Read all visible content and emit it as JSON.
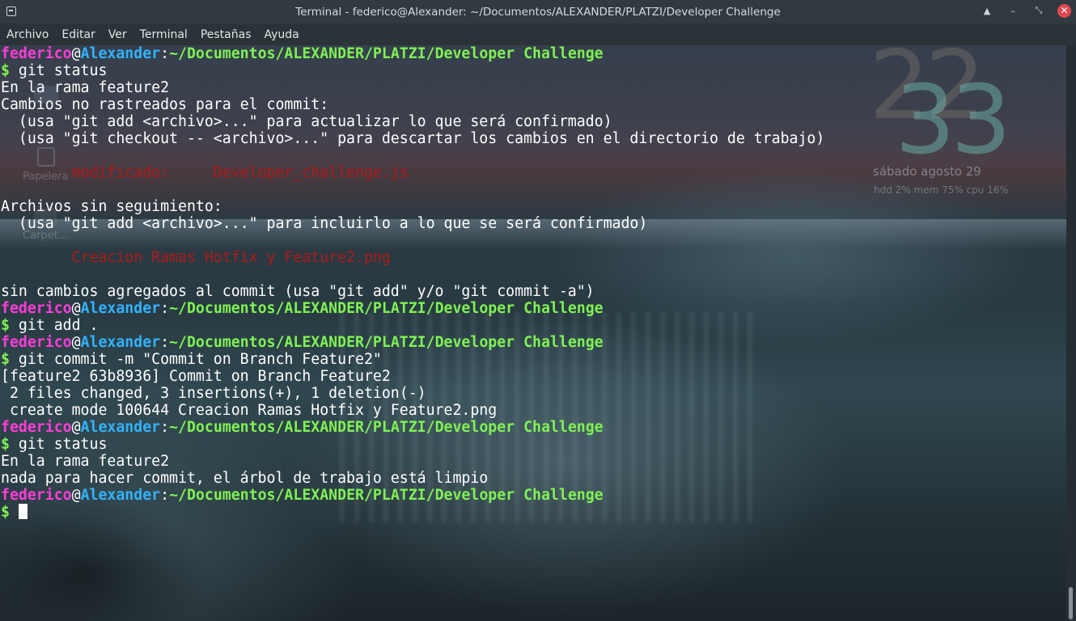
{
  "window": {
    "title": "Terminal - federico@Alexander: ~/Documentos/ALEXANDER/PLATZI/Developer Challenge"
  },
  "titlebar_controls": {
    "shade_icon": "▲",
    "minimize_icon": "–",
    "maximize_icon": "⤡",
    "close_icon": "✕"
  },
  "menu": [
    "Archivo",
    "Editar",
    "Ver",
    "Terminal",
    "Pestañas",
    "Ayuda"
  ],
  "prompt": {
    "user": "federico",
    "at": "@",
    "host": "Alexander",
    "colon": ":",
    "path": "~/Documentos/ALEXANDER/PLATZI/Developer Challenge",
    "symbol": "$"
  },
  "terminal_lines": [
    {
      "type": "prompt"
    },
    {
      "type": "command",
      "text": " git status"
    },
    {
      "type": "output",
      "text": "En la rama feature2"
    },
    {
      "type": "output",
      "text": "Cambios no rastreados para el commit:"
    },
    {
      "type": "output",
      "text": "  (usa \"git add <archivo>...\" para actualizar lo que será confirmado)"
    },
    {
      "type": "output",
      "text": "  (usa \"git checkout -- <archivo>...\" para descartar los cambios en el directorio de trabajo)"
    },
    {
      "type": "output",
      "text": ""
    },
    {
      "type": "modified",
      "text": "        modificado:     Developer_challenge.js"
    },
    {
      "type": "output",
      "text": ""
    },
    {
      "type": "output",
      "text": "Archivos sin seguimiento:"
    },
    {
      "type": "output",
      "text": "  (usa \"git add <archivo>...\" para incluirlo a lo que se será confirmado)"
    },
    {
      "type": "output",
      "text": ""
    },
    {
      "type": "untracked",
      "text": "        Creacion Ramas Hotfix y Feature2.png"
    },
    {
      "type": "output",
      "text": ""
    },
    {
      "type": "output",
      "text": "sin cambios agregados al commit (usa \"git add\" y/o \"git commit -a\")"
    },
    {
      "type": "prompt"
    },
    {
      "type": "command",
      "text": " git add ."
    },
    {
      "type": "prompt"
    },
    {
      "type": "command",
      "text": " git commit -m \"Commit on Branch Feature2\""
    },
    {
      "type": "output",
      "text": "[feature2 63b8936] Commit on Branch Feature2"
    },
    {
      "type": "output",
      "text": " 2 files changed, 3 insertions(+), 1 deletion(-)"
    },
    {
      "type": "output",
      "text": " create mode 100644 Creacion Ramas Hotfix y Feature2.png"
    },
    {
      "type": "prompt"
    },
    {
      "type": "command",
      "text": " git status"
    },
    {
      "type": "output",
      "text": "En la rama feature2"
    },
    {
      "type": "output",
      "text": "nada para hacer commit, el árbol de trabajo está limpio"
    },
    {
      "type": "prompt"
    },
    {
      "type": "input",
      "text": " "
    }
  ],
  "desktop": {
    "clock_hours": "22",
    "clock_minutes": "33",
    "date": "sábado   agosto 29",
    "stats": "hdd  2%   mem  75%   cpu   16%",
    "trash_label": "Papelera",
    "folder_label": "Carpet..."
  },
  "colors": {
    "user": "#ff3dd9",
    "host": "#32b3ff",
    "path": "#7ff253",
    "modified": "#ae1a1a",
    "text": "#ffffff"
  }
}
